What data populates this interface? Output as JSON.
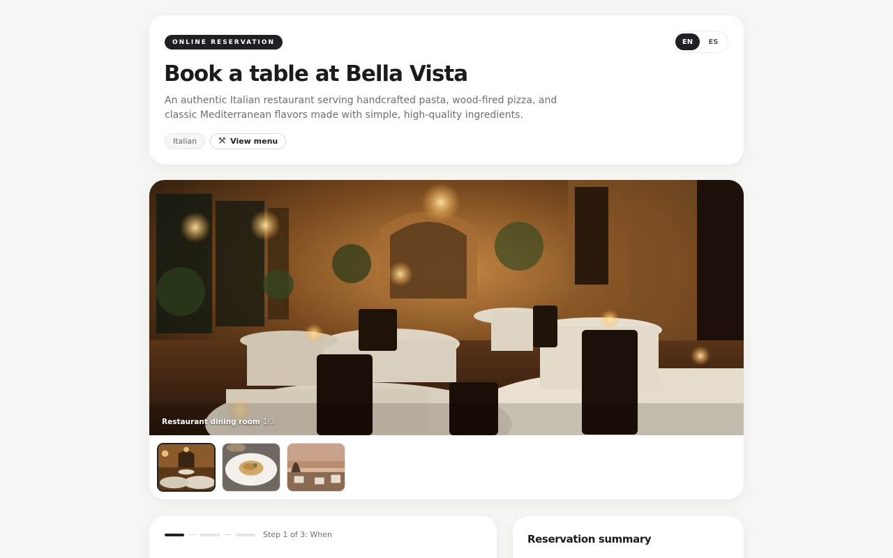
{
  "header": {
    "badge": "ONLINE RESERVATION",
    "title": "Book a table at Bella Vista",
    "description": "An authentic Italian restaurant serving handcrafted pasta, wood-fired pizza, and classic Mediterranean flavors made with simple, high-quality ingredients.",
    "tag": "Italian",
    "menu_button": "View menu",
    "menu_icon": "utensils-icon",
    "languages": [
      {
        "label": "EN",
        "active": true
      },
      {
        "label": "ES",
        "active": false
      }
    ]
  },
  "gallery": {
    "caption": "Restaurant dining room",
    "counter": "1/3",
    "thumbnails": [
      {
        "name": "dining-room",
        "active": true
      },
      {
        "name": "pasta-dish",
        "active": false
      },
      {
        "name": "terrace-view",
        "active": false
      }
    ]
  },
  "booking": {
    "step_label": "Step 1 of 3: When",
    "total_steps": 3,
    "current_step": 1
  },
  "summary": {
    "title": "Reservation summary"
  },
  "colors": {
    "accent": "#1f2024",
    "background": "#f5f5f4"
  }
}
